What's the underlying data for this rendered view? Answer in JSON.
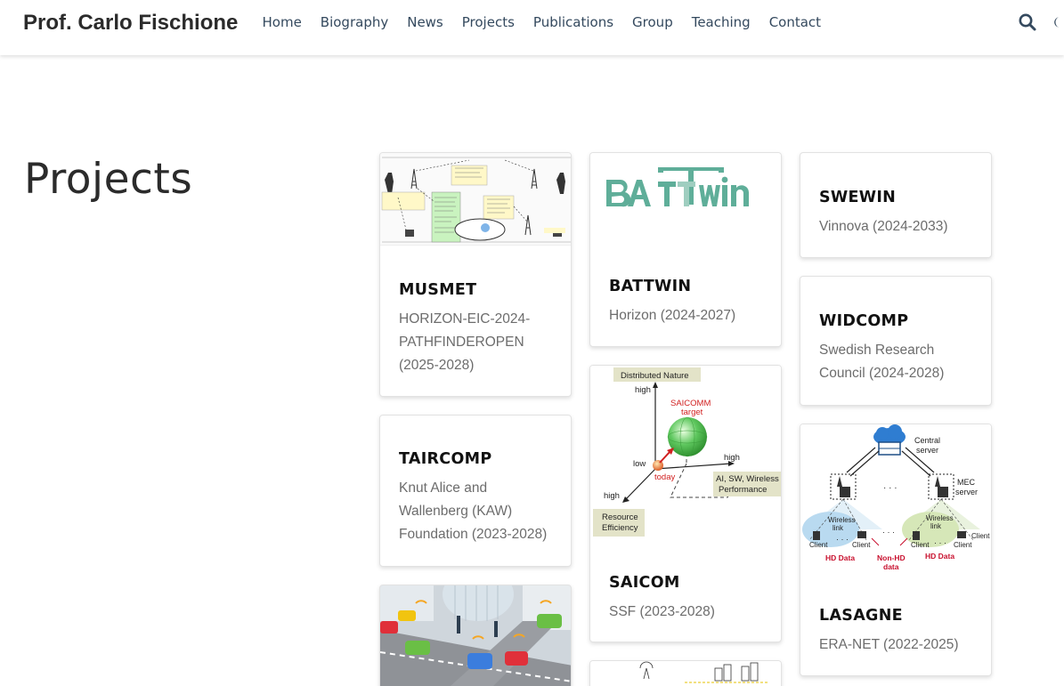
{
  "header": {
    "brand": "Prof. Carlo Fischione",
    "nav": [
      "Home",
      "Biography",
      "News",
      "Projects",
      "Publications",
      "Group",
      "Teaching",
      "Contact"
    ]
  },
  "page": {
    "title": "Projects"
  },
  "projects": [
    {
      "title": "MUSMET",
      "sub": "HORIZON-EIC-2024-PATHFINDEROPEN (2025-2028)"
    },
    {
      "title": "TAIRCOMP",
      "sub": "Knut Alice and Wallenberg (KAW) Foundation (2023-2028)"
    },
    {
      "title": "BATTWIN",
      "sub": "Horizon (2024-2027)",
      "logo_text": "BATTwin"
    },
    {
      "title": "SAICOM",
      "sub": "SSF (2023-2028)"
    },
    {
      "title": "SWEWIN",
      "sub": "Vinnova (2024-2033)"
    },
    {
      "title": "WIDCOMP",
      "sub": "Swedish Research Council (2024-2028)"
    },
    {
      "title": "LASAGNE",
      "sub": "ERA-NET (2022-2025)"
    }
  ],
  "saicom_figure": {
    "distributed": "Distributed Nature",
    "high_top": "high",
    "target_1": "SAICOMM",
    "target_2": "target",
    "low": "low",
    "today": "today",
    "high_right": "high",
    "ai_1": "AI, SW, Wireless",
    "ai_2": "Performance",
    "high_left": "high",
    "res_1": "Resource",
    "res_2": "Efficiency"
  },
  "lasagne_figure": {
    "central_1": "Central",
    "central_2": "server",
    "mec_1": "MEC",
    "mec_2": "server",
    "wireless_1": "Wireless",
    "wireless_2": "link",
    "client": "Client",
    "hd_data": "HD Data",
    "non_hd_1": "Non-HD",
    "non_hd_2": "data"
  },
  "colors": {
    "teal_logo": "#5fae99",
    "red_label": "#c8102e",
    "sphere": "#5ec75e"
  }
}
